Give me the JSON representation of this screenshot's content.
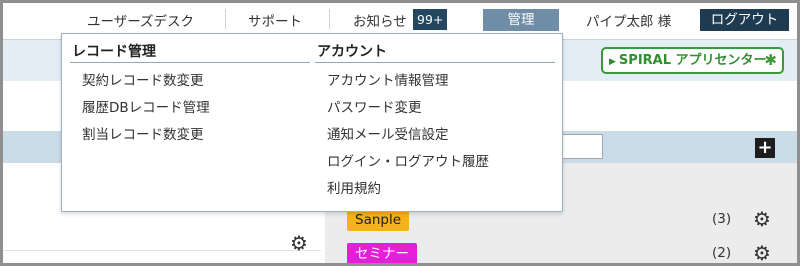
{
  "topnav": {
    "user_desk": "ユーザーズデスク",
    "support": "サポート",
    "notice": "お知らせ",
    "notice_count": "99+",
    "admin": "管理",
    "user_name": "パイプ太郎 様",
    "logout": "ログアウト"
  },
  "brand": {
    "spiral_label": "SPIRAL アプリセンター"
  },
  "dropdown": {
    "record_heading": "レコード管理",
    "record_items": [
      "契約レコード数変更",
      "履歴DBレコード管理",
      "割当レコード数変更"
    ],
    "account_heading": "アカウント",
    "account_items": [
      "アカウント情報管理",
      "パスワード変更",
      "通知メール受信設定",
      "ログイン・ログアウト履歴",
      "利用規約"
    ]
  },
  "list": {
    "rows": [
      {
        "tag": "Sanple",
        "count": "(3)",
        "color": "#f7b21a"
      },
      {
        "tag": "セミナー",
        "count": "(2)",
        "color": "#e51fd9"
      }
    ]
  },
  "colors": {
    "navy": "#1f3b51",
    "admin_blue": "#6f8da6",
    "spiral_green": "#3a9a3a"
  }
}
